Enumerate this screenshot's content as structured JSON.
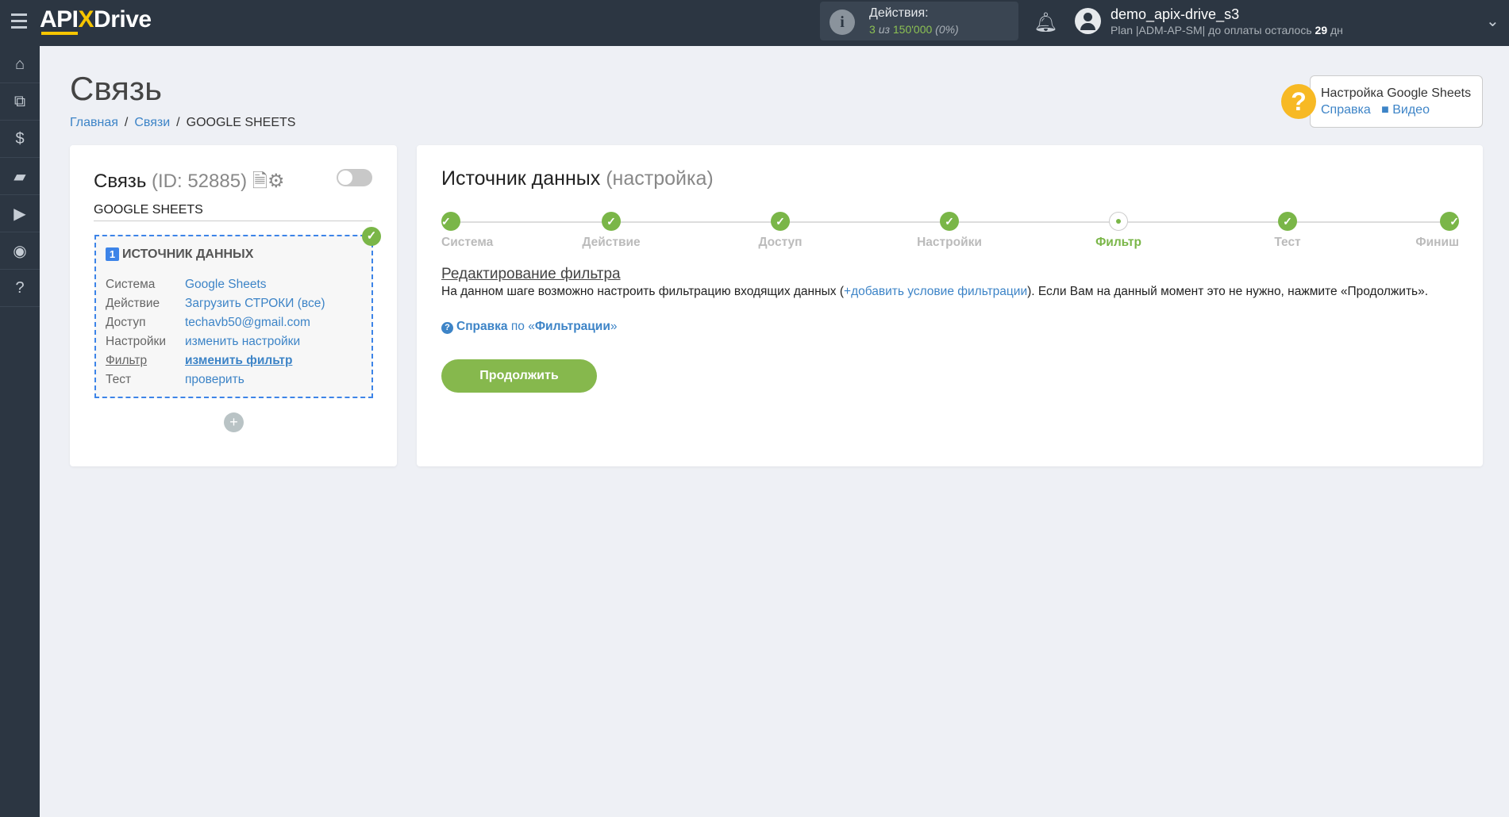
{
  "header": {
    "logo": "APIXDrive",
    "actions_label": "Действия:",
    "actions_used": "3",
    "actions_of": "из",
    "actions_total": "150'000",
    "actions_pct": "(0%)",
    "username": "demo_apix-drive_s3",
    "plan_text": "Plan |ADM-AP-SM| до оплаты осталось",
    "plan_days": "29",
    "plan_unit": "дн"
  },
  "sidebar": {
    "items": [
      "home",
      "sitemap",
      "billing",
      "briefcase",
      "video",
      "account",
      "help"
    ]
  },
  "page": {
    "title": "Связь",
    "breadcrumb": [
      "Главная",
      "Связи",
      "GOOGLE SHEETS"
    ]
  },
  "help_box": {
    "title": "Настройка Google Sheets",
    "help_link": "Справка",
    "video_link": "Видео"
  },
  "left_card": {
    "title": "Связь",
    "id_text": "(ID: 52885)",
    "connection_name": "GOOGLE SHEETS",
    "source_number": "1",
    "source_title": "ИСТОЧНИК ДАННЫХ",
    "rows": [
      {
        "k": "Система",
        "v": "Google Sheets"
      },
      {
        "k": "Действие",
        "v": "Загрузить СТРОКИ (все)"
      },
      {
        "k": "Доступ",
        "v": "techavb50@gmail.com"
      },
      {
        "k": "Настройки",
        "v": "изменить настройки"
      },
      {
        "k": "Фильтр",
        "v": "изменить фильтр"
      },
      {
        "k": "Тест",
        "v": "проверить"
      }
    ],
    "toggle_on": false
  },
  "right_card": {
    "title": "Источник данных",
    "title_sub": "(настройка)",
    "steps": [
      {
        "label": "Система",
        "state": "done"
      },
      {
        "label": "Действие",
        "state": "done"
      },
      {
        "label": "Доступ",
        "state": "done"
      },
      {
        "label": "Настройки",
        "state": "done"
      },
      {
        "label": "Фильтр",
        "state": "current"
      },
      {
        "label": "Тест",
        "state": "done"
      },
      {
        "label": "Финиш",
        "state": "done"
      }
    ],
    "subtitle": "Редактирование фильтра",
    "desc_1": "На данном шаге возможно настроить фильтрацию входящих данных (",
    "add_filter": "+добавить условие фильтрации",
    "desc_2": "). Если Вам на данный момент это не нужно, нажмите «Продолжить».",
    "help_1": "Справка",
    "help_2": "по «",
    "help_3": "Фильтрации",
    "help_4": "»",
    "continue": "Продолжить"
  },
  "colors": {
    "header": "#2c3642",
    "green": "#7ab648",
    "blue": "#3d84c7"
  }
}
